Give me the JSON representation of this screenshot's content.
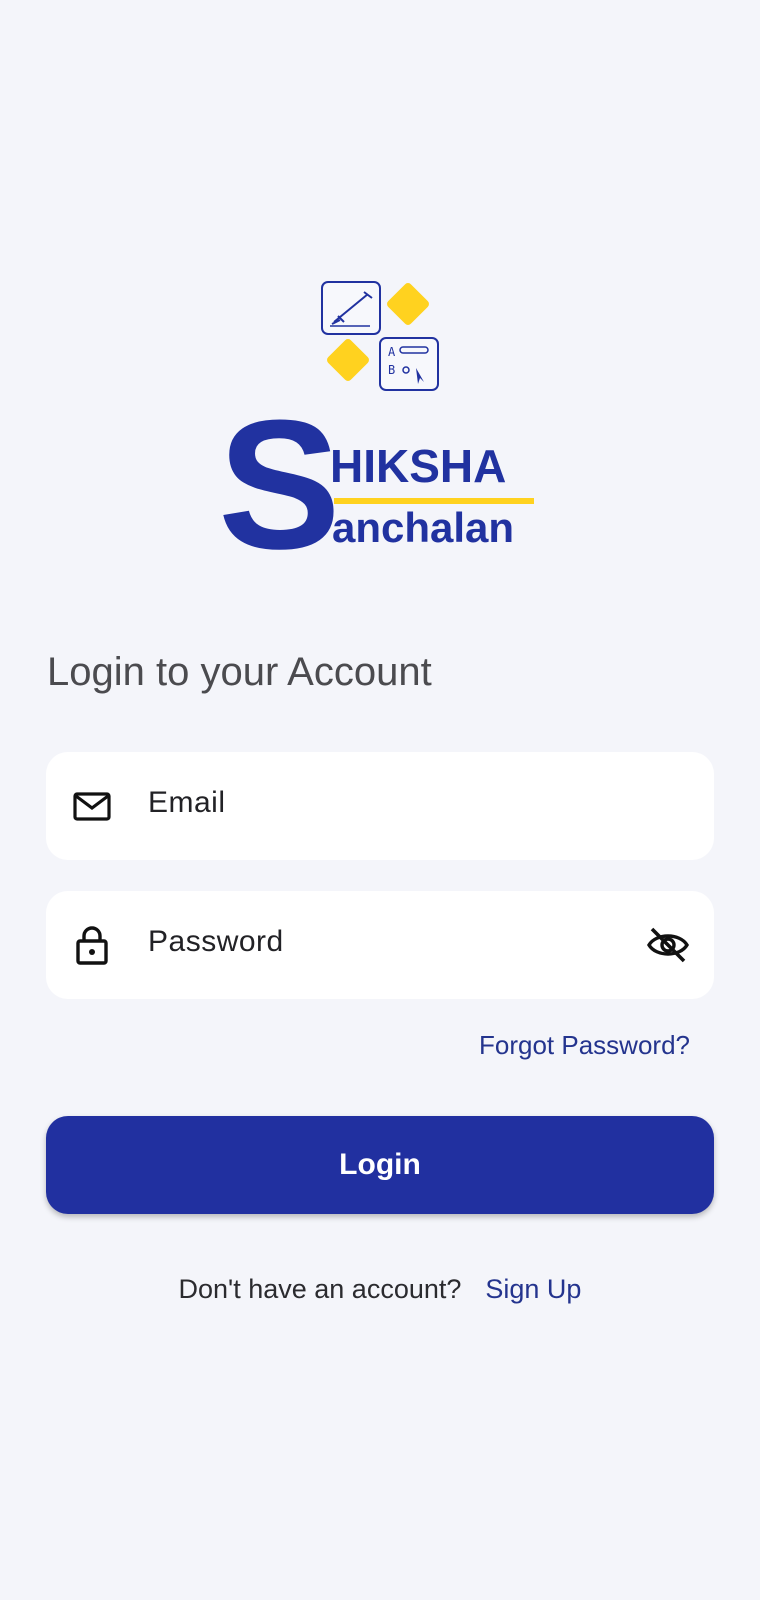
{
  "app": {
    "brand_top": "HIKSHA",
    "brand_bottom": "anchalan",
    "brand_letter": "S"
  },
  "form": {
    "heading": "Login to your Account",
    "email_placeholder": "Email",
    "password_placeholder": "Password",
    "forgot_label": "Forgot Password?",
    "login_label": "Login"
  },
  "footer": {
    "prompt": "Don't have an account?",
    "signup_label": "Sign Up"
  },
  "colors": {
    "primary": "#2132a0",
    "accent": "#ffd21f",
    "background": "#f4f5fa"
  },
  "icons": {
    "logo": "pen-and-quiz-logo-icon",
    "email": "mail-icon",
    "password": "lock-icon",
    "visibility": "eye-off-icon"
  }
}
